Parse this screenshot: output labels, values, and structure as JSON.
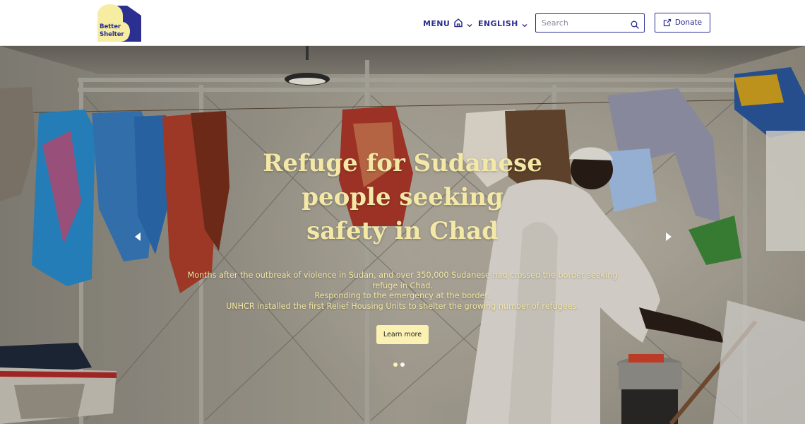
{
  "header": {
    "logo_line1": "Better",
    "logo_line2": "Shelter",
    "menu_label": "MENU",
    "language_label": "ENGLISH",
    "search_placeholder": "Search",
    "donate_label": "Donate"
  },
  "hero": {
    "title_line1": "Refuge for Sudanese",
    "title_line2": "people seeking",
    "title_line3": "safety in Chad",
    "description_line1": "Months after the outbreak of violence in Sudan, and over 350,000 Sudanese had crossed the border seeking",
    "description_line2": "refuge in Chad.",
    "description_line3": "Responding to the emergency at the border,",
    "description_line4": "UNHCR installed the first Relief Housing Units to shelter the growing number of refugees.",
    "cta_label": "Learn more",
    "slide_count": 2,
    "active_slide": 1
  },
  "colors": {
    "brand_navy": "#2b2f8f",
    "brand_cream": "#f4e8a6",
    "button_cream": "#fbf1b3",
    "logo_yellow": "#f6eda3"
  },
  "icons": {
    "menu": "home-icon",
    "menu_chevron": "chevron-down-icon",
    "language_chevron": "chevron-down-icon",
    "search": "search-icon",
    "donate": "external-link-icon",
    "prev": "arrow-left-icon",
    "next": "arrow-right-icon"
  }
}
